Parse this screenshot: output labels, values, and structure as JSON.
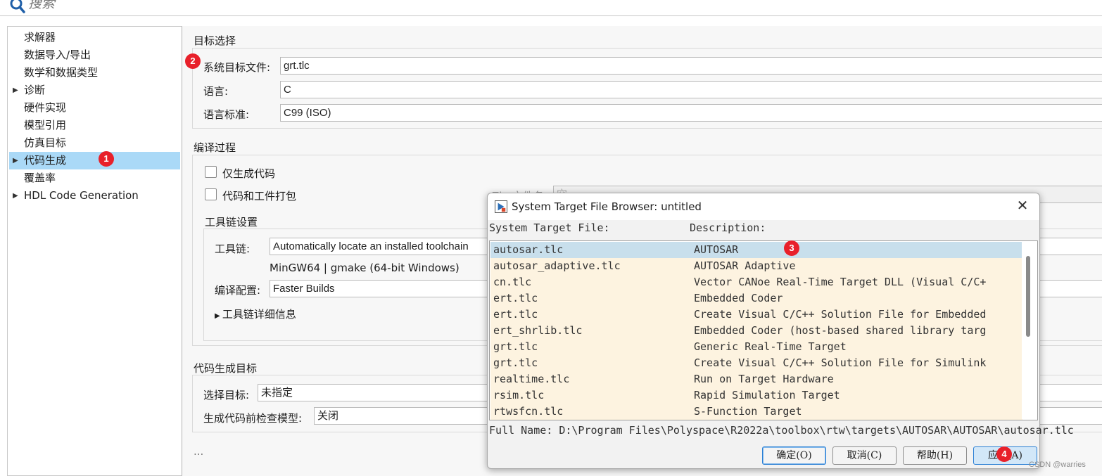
{
  "search": {
    "placeholder": "搜索"
  },
  "tree": {
    "items": [
      {
        "label": "求解器",
        "expandable": false
      },
      {
        "label": "数据导入/导出",
        "expandable": false
      },
      {
        "label": "数学和数据类型",
        "expandable": false
      },
      {
        "label": "诊断",
        "expandable": true
      },
      {
        "label": "硬件实现",
        "expandable": false
      },
      {
        "label": "模型引用",
        "expandable": false
      },
      {
        "label": "仿真目标",
        "expandable": false
      },
      {
        "label": "代码生成",
        "expandable": true,
        "selected": true
      },
      {
        "label": "覆盖率",
        "expandable": false
      },
      {
        "label": "HDL Code Generation",
        "expandable": true
      }
    ]
  },
  "target_selection": {
    "title": "目标选择",
    "system_target_file_label": "系统目标文件:",
    "system_target_file_value": "grt.tlc",
    "language_label": "语言:",
    "language_value": "C",
    "language_standard_label": "语言标准:",
    "language_standard_value": "C99 (ISO)"
  },
  "build_process": {
    "title": "编译过程",
    "generate_code_only_label": "仅生成代码",
    "package_code_label": "代码和工件打包",
    "zip_file_label": "Zip 文件名:",
    "zip_file_value": "空",
    "toolchain_settings_title": "工具链设置",
    "toolchain_label": "工具链:",
    "toolchain_value": "Automatically locate an installed toolchain",
    "toolchain_info": "MinGW64 | gmake (64-bit Windows)",
    "build_config_label": "编译配置:",
    "build_config_value": "Faster Builds",
    "toolchain_details_label": "工具链详细信息"
  },
  "code_gen_objectives": {
    "title": "代码生成目标",
    "select_objective_label": "选择目标:",
    "select_objective_value": "未指定",
    "check_model_label": "生成代码前检查模型:",
    "check_model_value": "关闭"
  },
  "panel_footer": {
    "ellipsis": "..."
  },
  "dialog": {
    "title": "System Target File Browser: untitled",
    "col1_header": "System Target File:",
    "col2_header": "Description:",
    "rows": [
      {
        "file": "autosar.tlc",
        "desc": "AUTOSAR",
        "selected": true
      },
      {
        "file": "autosar_adaptive.tlc",
        "desc": "AUTOSAR Adaptive"
      },
      {
        "file": "cn.tlc",
        "desc": "Vector CANoe Real-Time Target DLL (Visual C/C+"
      },
      {
        "file": "ert.tlc",
        "desc": "Embedded Coder"
      },
      {
        "file": "ert.tlc",
        "desc": "Create Visual C/C++ Solution File for Embedded"
      },
      {
        "file": "ert_shrlib.tlc",
        "desc": "Embedded Coder (host-based shared library targ"
      },
      {
        "file": "grt.tlc",
        "desc": "Generic Real-Time Target"
      },
      {
        "file": "grt.tlc",
        "desc": "Create Visual C/C++ Solution File for Simulink"
      },
      {
        "file": "realtime.tlc",
        "desc": "Run on Target Hardware"
      },
      {
        "file": "rsim.tlc",
        "desc": "Rapid Simulation Target"
      },
      {
        "file": "rtwsfcn.tlc",
        "desc": "S-Function Target"
      }
    ],
    "full_name": "Full Name: D:\\Program Files\\Polyspace\\R2022a\\toolbox\\rtw\\targets\\AUTOSAR\\AUTOSAR\\autosar.tlc",
    "buttons": {
      "ok": "确定(O)",
      "cancel": "取消(C)",
      "help": "帮助(H)",
      "apply": "应用(A)"
    }
  },
  "annotations": [
    "1",
    "2",
    "3",
    "4"
  ],
  "watermark": "CSDN @warries"
}
